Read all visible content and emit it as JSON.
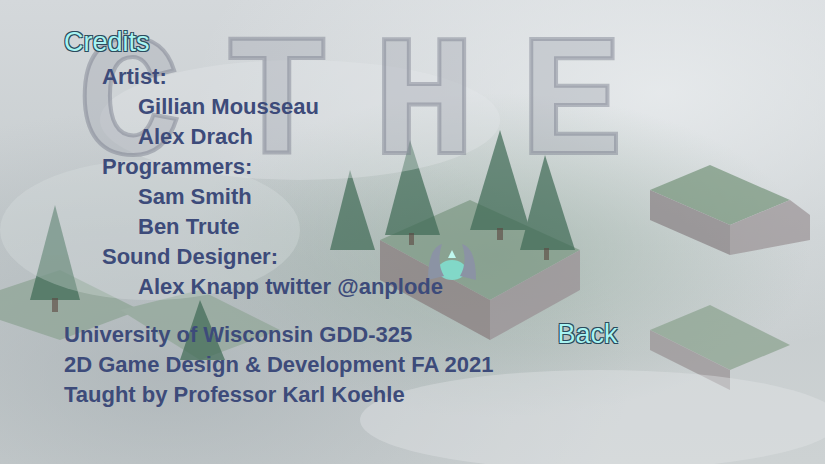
{
  "title": "Credits",
  "logo_text": "CTHE",
  "sections": [
    {
      "role": "Artist:",
      "names": [
        "Gillian Mousseau",
        "Alex Drach"
      ]
    },
    {
      "role": "Programmers:",
      "names": [
        "Sam Smith",
        "Ben Trute"
      ]
    },
    {
      "role": "Sound Designer:",
      "names": [
        "Alex Knapp twitter @anplode"
      ]
    }
  ],
  "footer": [
    "University of Wisconsin GDD-325",
    "2D Game Design & Development FA 2021",
    "Taught by Professor Karl Koehle"
  ],
  "back_button": "Back"
}
